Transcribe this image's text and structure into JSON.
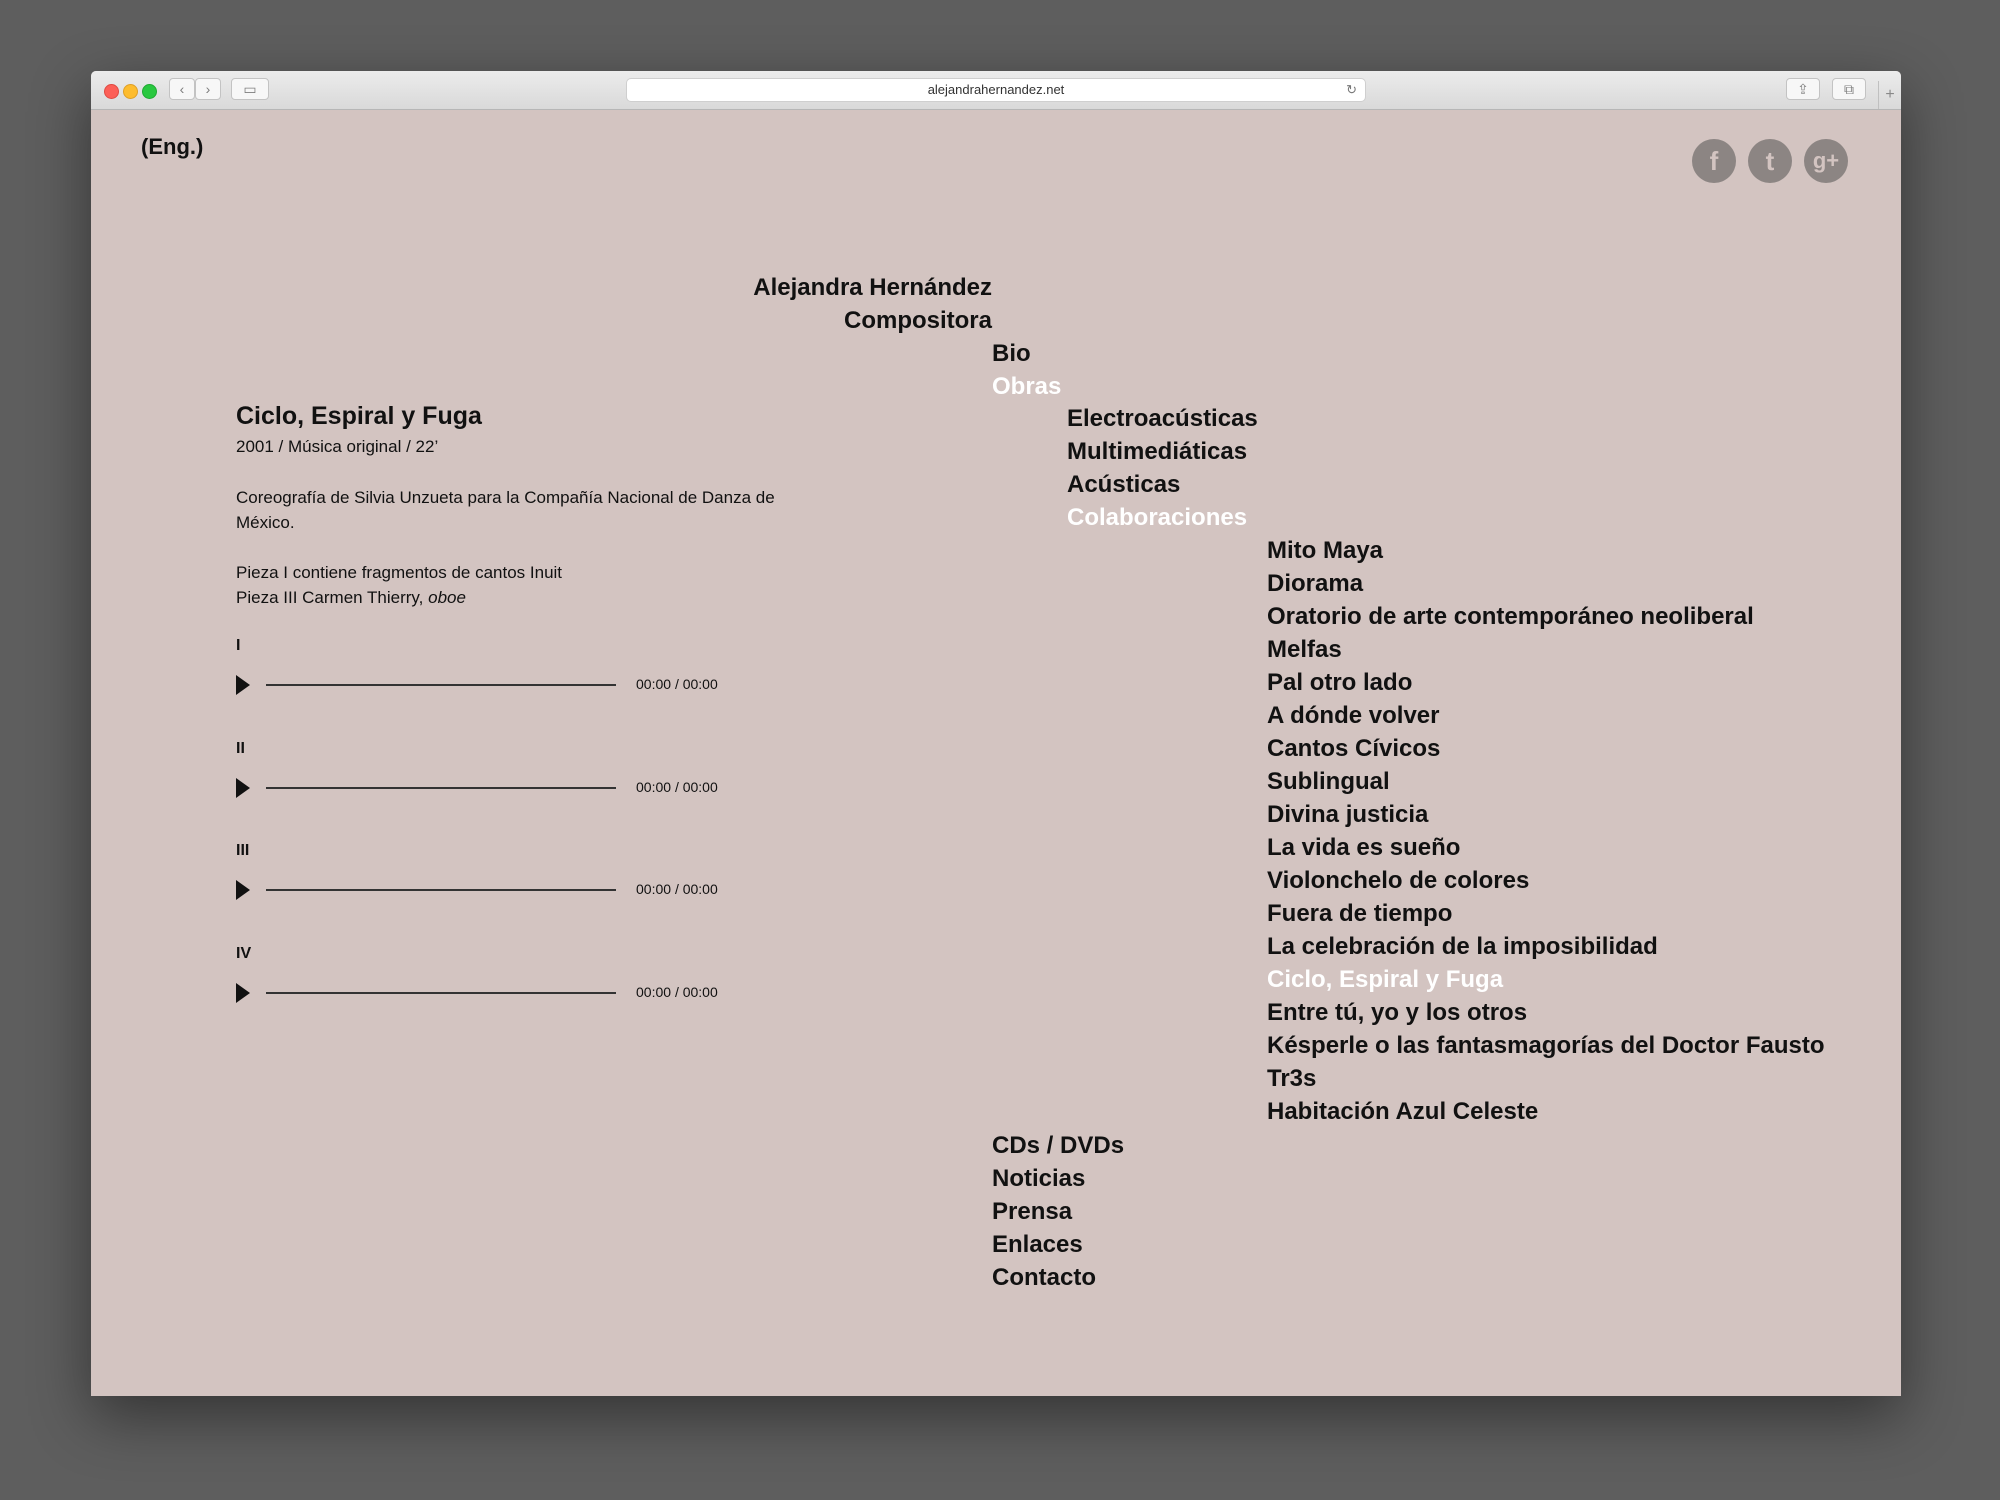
{
  "browser": {
    "url": "alejandrahernandez.net"
  },
  "header": {
    "lang_link": "(Eng.)",
    "social": [
      {
        "icon": "facebook-icon",
        "glyph": "f"
      },
      {
        "icon": "twitter-icon",
        "glyph": "t"
      },
      {
        "icon": "google-plus-icon",
        "glyph": "g+"
      }
    ]
  },
  "nav": {
    "name": "Alejandra Hernández",
    "role": "Compositora",
    "bio": "Bio",
    "obras": "Obras",
    "categories": [
      "Electroacústicas",
      "Multimediáticas",
      "Acústicas",
      "Colaboraciones"
    ],
    "works": [
      "Mito Maya",
      "Diorama",
      "Oratorio de arte contemporáneo neoliberal",
      "Melfas",
      "Pal otro lado",
      "A dónde volver",
      "Cantos Cívicos",
      "Sublingual",
      "Divina justicia",
      "La vida es sueño",
      "Violonchelo de colores",
      "Fuera de tiempo",
      "La celebración de la imposibilidad",
      "Ciclo, Espiral y Fuga",
      "Entre tú, yo y los otros",
      "Késperle o las fantasmagorías del Doctor Fausto",
      "Tr3s",
      "Habitación Azul Celeste"
    ],
    "bottom": [
      "CDs / DVDs",
      "Noticias",
      "Prensa",
      "Enlaces",
      "Contacto"
    ]
  },
  "work": {
    "title": "Ciclo, Espiral y Fuga",
    "meta": "2001 / Música original / 22’",
    "description": "Coreografía de Silvia Unzueta para la Compañía Nacional de Danza de México.",
    "note_line1": "Pieza I contiene fragmentos de cantos Inuit",
    "note_line2_prefix": "Pieza III Carmen Thierry, ",
    "note_line2_instrument": "oboe",
    "tracks": [
      {
        "label": "I",
        "current": "00:00",
        "sep": "/",
        "duration": "00:00"
      },
      {
        "label": "II",
        "current": "00:00",
        "sep": "/",
        "duration": "00:00"
      },
      {
        "label": "III",
        "current": "00:00",
        "sep": "/",
        "duration": "00:00"
      },
      {
        "label": "IV",
        "current": "00:00",
        "sep": "/",
        "duration": "00:00"
      }
    ]
  }
}
